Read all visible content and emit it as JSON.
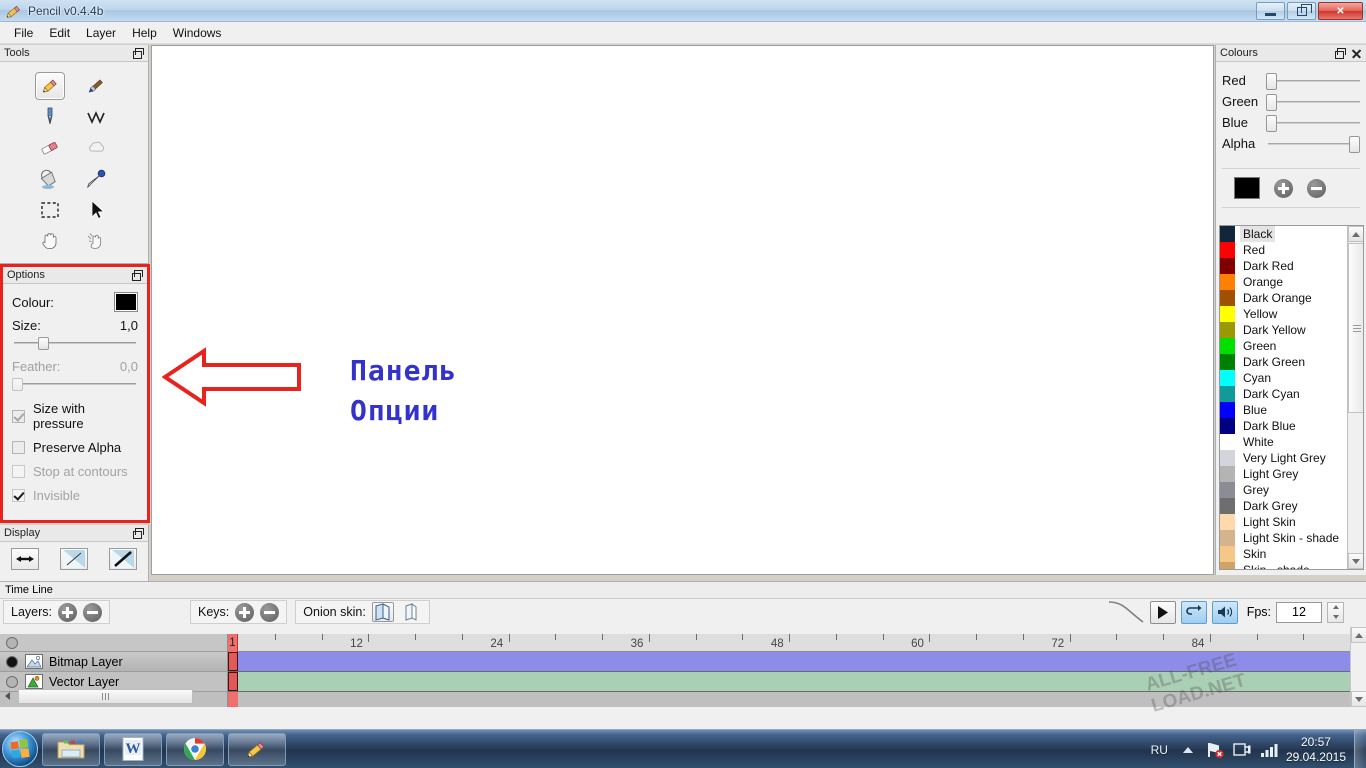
{
  "window": {
    "title": "Pencil v0.4.4b",
    "app_icon": "pencil-icon",
    "minimize_label": "",
    "maximize_label": "",
    "close_label": "✕"
  },
  "menubar": {
    "items": [
      {
        "label": "File"
      },
      {
        "label": "Edit"
      },
      {
        "label": "Layer"
      },
      {
        "label": "Help"
      },
      {
        "label": "Windows"
      }
    ]
  },
  "tools_panel": {
    "title": "Tools",
    "tools": [
      {
        "name": "pencil-tool",
        "glyph": "✎",
        "selected": true
      },
      {
        "name": "brush-tool",
        "glyph": "🖌",
        "selected": false
      },
      {
        "name": "pen-tool",
        "glyph": "🖊",
        "selected": false
      },
      {
        "name": "polyline-tool",
        "glyph": "∨",
        "selected": false
      },
      {
        "name": "eraser-tool",
        "glyph": "▰",
        "selected": false
      },
      {
        "name": "smudge-tool",
        "glyph": "☁",
        "selected": false
      },
      {
        "name": "bucket-tool",
        "glyph": "⛶",
        "selected": false
      },
      {
        "name": "eyedropper-tool",
        "glyph": "⚲",
        "selected": false
      },
      {
        "name": "select-tool",
        "glyph": "⬚",
        "selected": false
      },
      {
        "name": "move-tool",
        "glyph": "➤",
        "selected": false
      },
      {
        "name": "hand-tool",
        "glyph": "✋",
        "selected": false
      },
      {
        "name": "clear-tool",
        "glyph": "☄",
        "selected": false
      }
    ]
  },
  "options_panel": {
    "title": "Options",
    "colour_label": "Colour:",
    "colour_value": "#000000",
    "size_label": "Size:",
    "size_value": "1,0",
    "size_slider_percent": 22,
    "feather_label": "Feather:",
    "feather_value": "0,0",
    "feather_slider_percent": 1,
    "checkboxes": [
      {
        "label": "Size with pressure",
        "checked": true,
        "enabled": true,
        "style": "gray"
      },
      {
        "label": "Preserve Alpha",
        "checked": false,
        "enabled": true,
        "style": "gray"
      },
      {
        "label": "Stop at contours",
        "checked": false,
        "enabled": false,
        "style": "disabled"
      },
      {
        "label": "Invisible",
        "checked": true,
        "enabled": false,
        "style": "disabled"
      }
    ],
    "highlight_color": "#e8231e"
  },
  "display_panel": {
    "title": "Display",
    "buttons": [
      {
        "name": "mirror-horizontal-button",
        "glyph": "⬌"
      },
      {
        "name": "thin-lines-button",
        "glyph": "/"
      },
      {
        "name": "thick-lines-button",
        "glyph": "/"
      }
    ]
  },
  "canvas": {
    "annotation_arrow": "left-arrow-annotation",
    "annotation_lines": [
      "Панель",
      "Опции"
    ],
    "annotation_color": "#3333cc",
    "arrow_color": "#e8231e",
    "background": "#ffffff"
  },
  "colours_panel": {
    "title": "Colours",
    "sliders": [
      {
        "label": "Red",
        "percent": 0
      },
      {
        "label": "Green",
        "percent": 0
      },
      {
        "label": "Blue",
        "percent": 0
      },
      {
        "label": "Alpha",
        "percent": 100
      }
    ],
    "current_swatch": "#000000",
    "add_button_label": "add-colour",
    "remove_button_label": "remove-colour",
    "list": [
      {
        "name": "Black",
        "hex": "#12263a",
        "selected": true
      },
      {
        "name": "Red",
        "hex": "#fe0000",
        "selected": false
      },
      {
        "name": "Dark Red",
        "hex": "#800000",
        "selected": false
      },
      {
        "name": "Orange",
        "hex": "#ff8000",
        "selected": false
      },
      {
        "name": "Dark Orange",
        "hex": "#a05000",
        "selected": false
      },
      {
        "name": "Yellow",
        "hex": "#ffff00",
        "selected": false
      },
      {
        "name": "Dark Yellow",
        "hex": "#9a9a00",
        "selected": false
      },
      {
        "name": "Green",
        "hex": "#00e000",
        "selected": false
      },
      {
        "name": "Dark Green",
        "hex": "#008000",
        "selected": false
      },
      {
        "name": "Cyan",
        "hex": "#00ffff",
        "selected": false
      },
      {
        "name": "Dark Cyan",
        "hex": "#109a9a",
        "selected": false
      },
      {
        "name": "Blue",
        "hex": "#0000ff",
        "selected": false
      },
      {
        "name": "Dark Blue",
        "hex": "#000080",
        "selected": false
      },
      {
        "name": "White",
        "hex": "#ffffff",
        "selected": false
      },
      {
        "name": "Very Light Grey",
        "hex": "#d4d4dc",
        "selected": false
      },
      {
        "name": "Light Grey",
        "hex": "#b4b4b4",
        "selected": false
      },
      {
        "name": "Grey",
        "hex": "#8c8c96",
        "selected": false
      },
      {
        "name": "Dark Grey",
        "hex": "#6e6e6e",
        "selected": false
      },
      {
        "name": "Light Skin",
        "hex": "#ffd9ac",
        "selected": false
      },
      {
        "name": "Light Skin - shade",
        "hex": "#d4b48c",
        "selected": false
      },
      {
        "name": "Skin",
        "hex": "#f5c888",
        "selected": false
      },
      {
        "name": "Skin - shade",
        "hex": "#d0a468",
        "selected": false
      }
    ]
  },
  "timeline": {
    "title": "Time Line",
    "layers_label": "Layers:",
    "layers_add": "add-layer",
    "layers_remove": "remove-layer",
    "keys_label": "Keys:",
    "keys_add": "add-key",
    "keys_remove": "remove-key",
    "onion_label": "Onion skin:",
    "onion_buttons": [
      {
        "name": "onion-skin-previous-button",
        "active": true
      },
      {
        "name": "onion-skin-next-button",
        "active": false
      }
    ],
    "play_button": "play-button",
    "loop_button": "loop-button",
    "sound_button": "sound-button",
    "fps_label": "Fps:",
    "fps_value": "12",
    "ruler_marks": [
      1,
      12,
      24,
      36,
      48,
      60,
      72,
      84
    ],
    "frame_count": 96,
    "current_frame": 1,
    "layers": [
      {
        "name": "Bitmap Layer",
        "icon": "bitmap-layer-icon",
        "visible": true,
        "selected": true,
        "track_color": "#8d8ce8"
      },
      {
        "name": "Vector Layer",
        "icon": "vector-layer-icon",
        "visible": false,
        "selected": false,
        "track_color": "#a9cfb4"
      }
    ]
  },
  "watermark": {
    "line1": "ALL-FREE",
    "line2": "LOAD.NET"
  },
  "taskbar": {
    "start_button": "start-orb",
    "buttons": [
      {
        "name": "taskbar-explorer-button",
        "icon": "folder-icon"
      },
      {
        "name": "taskbar-word-button",
        "icon": "word-icon"
      },
      {
        "name": "taskbar-chrome-button",
        "icon": "chrome-icon"
      },
      {
        "name": "taskbar-pencil-button",
        "icon": "pencil-icon"
      }
    ],
    "language": "RU",
    "tray_icons": [
      "network-error-icon",
      "plug-icon",
      "signal-icon"
    ],
    "time": "20:57",
    "date": "29.04.2015"
  }
}
